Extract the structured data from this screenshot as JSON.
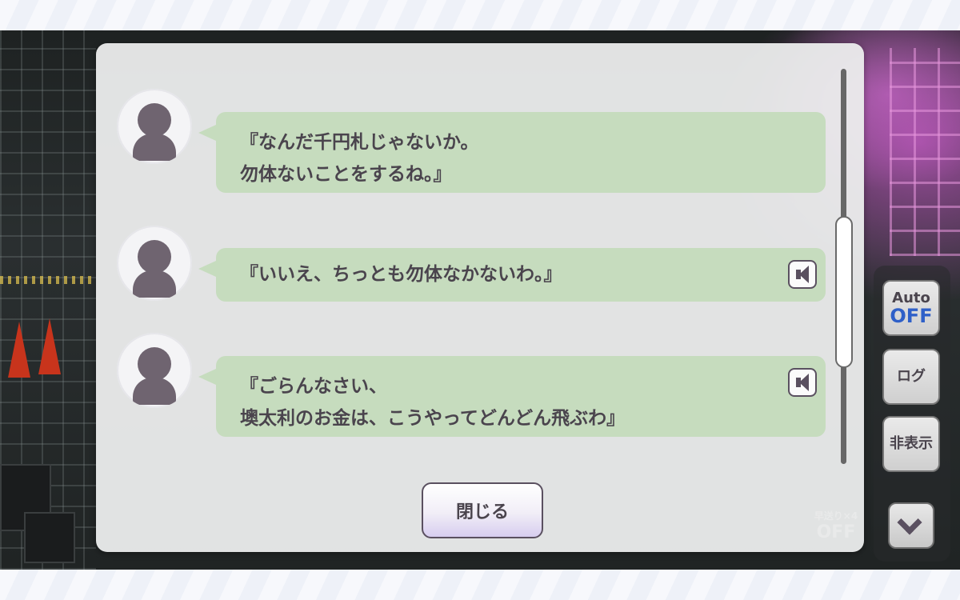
{
  "log": {
    "entries": [
      {
        "lines": [
          "『なんだ千円札じゃないか。",
          "勿体ないことをするね。』"
        ],
        "has_voice": false
      },
      {
        "lines": [
          "『いいえ、ちっとも勿体なかないわ。』"
        ],
        "has_voice": true
      },
      {
        "lines": [
          "『ごらんなさい、",
          "墺太利のお金は、こうやってどんどん飛ぶわ』"
        ],
        "has_voice": true
      }
    ],
    "close_label": "閉じる"
  },
  "controls": {
    "auto_label": "Auto",
    "auto_state": "OFF",
    "log_label": "ログ",
    "hide_label": "非表示",
    "skip_label": "早送り×4",
    "skip_state": "OFF"
  },
  "icons": {
    "voice": "speaker-icon",
    "avatar": "silhouette-icon",
    "down": "chevron-down-icon"
  },
  "colors": {
    "bubble": "#c6dcbe",
    "text": "#4a444d",
    "auto_off": "#2f60c8"
  }
}
